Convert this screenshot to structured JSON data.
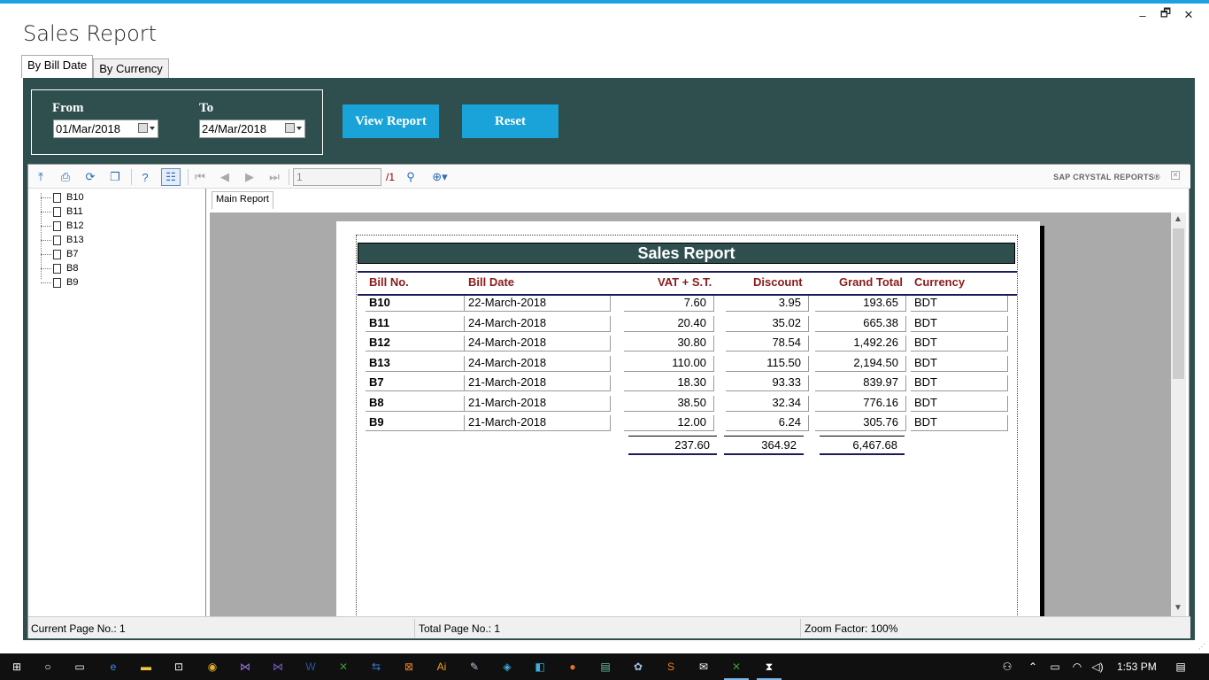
{
  "window": {
    "title": "Sales Report",
    "controls": {
      "minimize": "–",
      "restore": "🗗",
      "close": "✕"
    },
    "accent": "#1ba1e2"
  },
  "tabs": [
    {
      "label": "By Bill Date",
      "active": true
    },
    {
      "label": "By Currency",
      "active": false
    }
  ],
  "filters": {
    "from_label": "From",
    "from_value": "01/Mar/2018",
    "to_label": "To",
    "to_value": "24/Mar/2018",
    "view_button": "View Report",
    "reset_button": "Reset",
    "panel_color": "#2f4f4f",
    "button_color": "#1aa3d9"
  },
  "viewer": {
    "toolbar": {
      "icons": [
        "export-icon",
        "print-icon",
        "refresh-icon",
        "copy-icon",
        "help-icon",
        "group-tree-icon",
        "first-page-icon",
        "prev-page-icon",
        "next-page-icon",
        "last-page-icon",
        "find-icon",
        "zoom-icon"
      ],
      "page_value": "1",
      "page_total": "/1",
      "brand": "SAP CRYSTAL REPORTS®"
    },
    "tree": [
      "B10",
      "B11",
      "B12",
      "B13",
      "B7",
      "B8",
      "B9"
    ],
    "main_tab": "Main Report",
    "status": {
      "current_page": "Current Page No.: 1",
      "total_page": "Total Page No.: 1",
      "zoom": "Zoom Factor: 100%"
    }
  },
  "report": {
    "title": "Sales Report",
    "columns": [
      "Bill No.",
      "Bill Date",
      "VAT + S.T.",
      "Discount",
      "Grand Total",
      "Currency"
    ],
    "rows": [
      {
        "bill": "B10",
        "date": "22-March-2018",
        "vat": "7.60",
        "discount": "3.95",
        "total": "193.65",
        "currency": "BDT"
      },
      {
        "bill": "B11",
        "date": "24-March-2018",
        "vat": "20.40",
        "discount": "35.02",
        "total": "665.38",
        "currency": "BDT"
      },
      {
        "bill": "B12",
        "date": "24-March-2018",
        "vat": "30.80",
        "discount": "78.54",
        "total": "1,492.26",
        "currency": "BDT"
      },
      {
        "bill": "B13",
        "date": "24-March-2018",
        "vat": "110.00",
        "discount": "115.50",
        "total": "2,194.50",
        "currency": "BDT"
      },
      {
        "bill": "B7",
        "date": "21-March-2018",
        "vat": "18.30",
        "discount": "93.33",
        "total": "839.97",
        "currency": "BDT"
      },
      {
        "bill": "B8",
        "date": "21-March-2018",
        "vat": "38.50",
        "discount": "32.34",
        "total": "776.16",
        "currency": "BDT"
      },
      {
        "bill": "B9",
        "date": "21-March-2018",
        "vat": "12.00",
        "discount": "6.24",
        "total": "305.76",
        "currency": "BDT"
      }
    ],
    "totals": {
      "vat": "237.60",
      "discount": "364.92",
      "total": "6,467.68"
    },
    "header_color": "#8b1a1a"
  },
  "taskbar": {
    "time": "1:53 PM",
    "apps": [
      "start-icon",
      "search-icon",
      "task-view-icon",
      "edge-icon",
      "file-explorer-icon",
      "store-icon",
      "chrome-icon",
      "visual-studio-icon",
      "visual-studio-alt-icon",
      "word-icon",
      "app-icon",
      "teamviewer-icon",
      "sublime-icon",
      "illustrator-icon",
      "paint-icon",
      "app-icon-2",
      "app-icon-3",
      "firefox-icon",
      "notepad-icon",
      "paint3d-icon",
      "sublime-text-icon",
      "mail-icon",
      "app-active-icon",
      "hourglass-icon"
    ]
  }
}
